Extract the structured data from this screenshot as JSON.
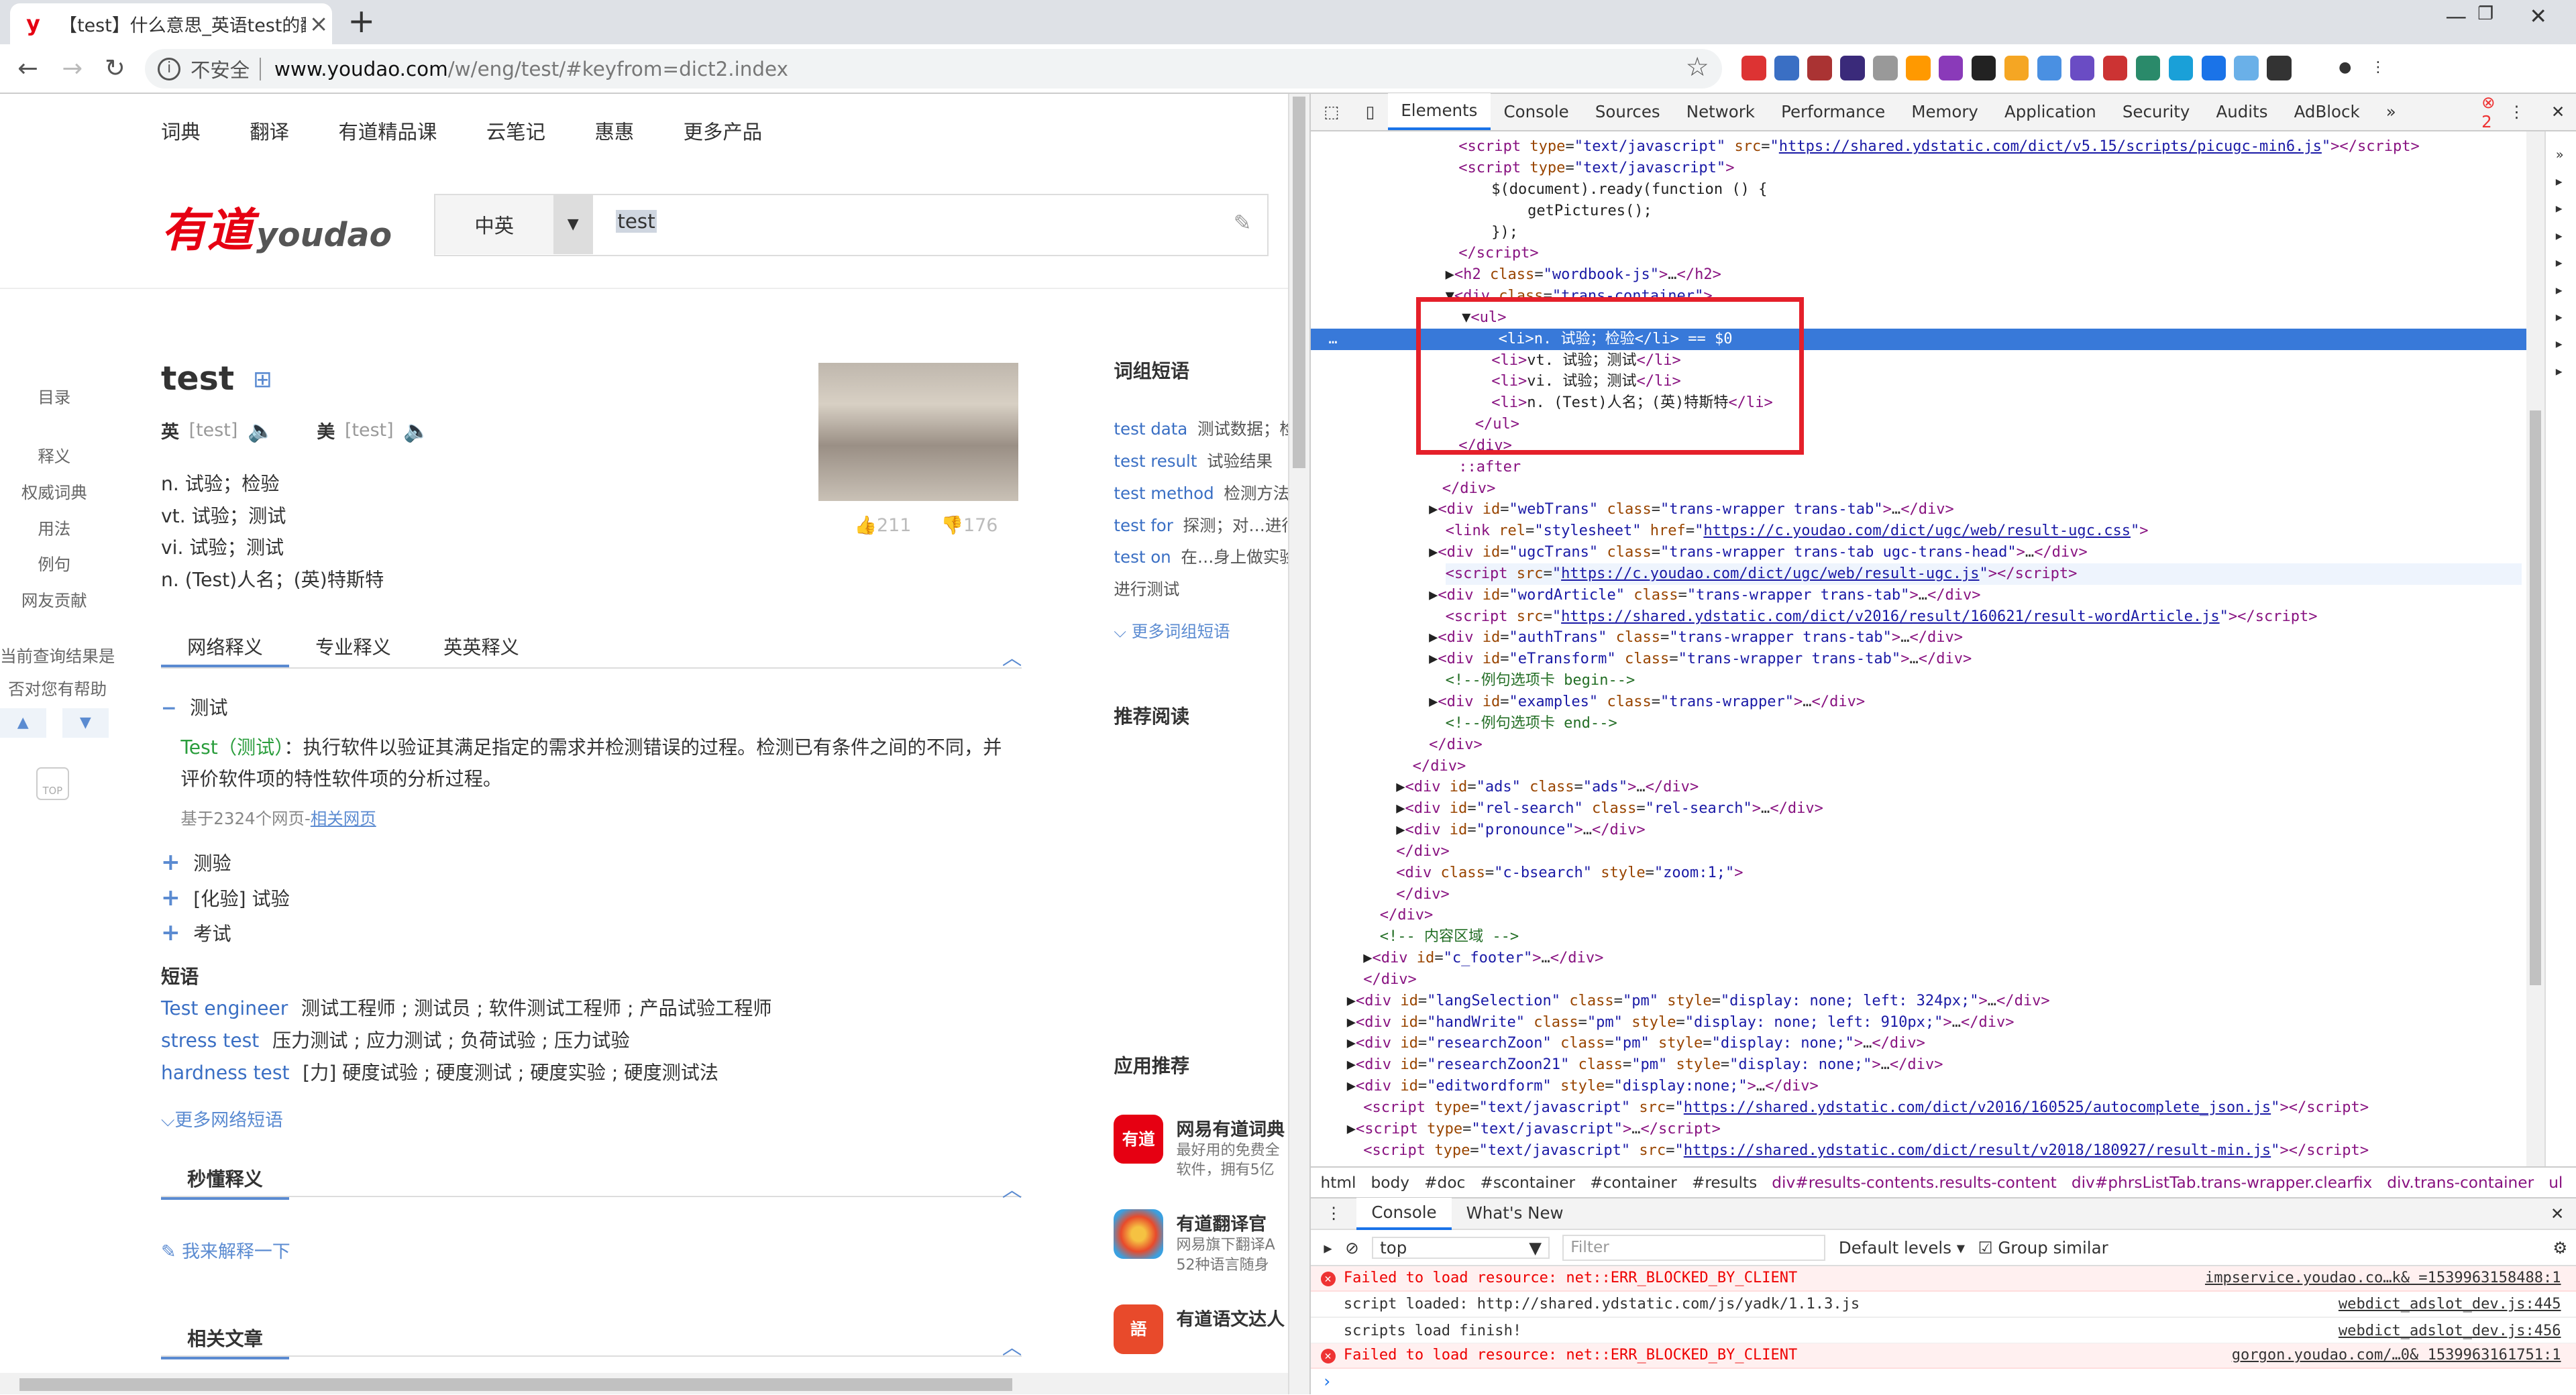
{
  "browser": {
    "tab_title": "【test】什么意思_英语test的翻译_音标_读音_用法_例句_在线翻译_有道词典",
    "tab_favicon": "y",
    "security": "不安全",
    "url_host": "www.youdao.com",
    "url_path": "/w/eng/test/#keyfrom=dict2.index"
  },
  "page": {
    "nav": [
      "词典",
      "翻译",
      "有道精品课",
      "云笔记",
      "惠惠",
      "更多产品"
    ],
    "logo_cn": "有道",
    "logo_en": "youdao",
    "lang_select": "中英",
    "search_value": "test",
    "toc": [
      "目录",
      "释义",
      "权威词典",
      "用法",
      "例句",
      "网友贡献"
    ],
    "side_note_1": "当前查询结果是",
    "side_note_2": "否对您有帮助",
    "top_label": "TOP",
    "word": "test",
    "phon_uk_label": "英",
    "phon_uk": "[test]",
    "phon_us_label": "美",
    "phon_us": "[test]",
    "defs": [
      "n. 试验；检验",
      "vt. 试验；测试",
      "vi. 试验；测试",
      "n. (Test)人名；(英)特斯特"
    ],
    "likes": "211",
    "dislikes": "176",
    "tabs": [
      "网络释义",
      "专业释义",
      "英英释义"
    ],
    "net_title": "测试",
    "net_kw": "Test",
    "net_kw_cn": "测试",
    "net_desc": "：执行软件以验证其满足指定的需求并检测错误的过程。检测已有条件之间的不同，并评价软件项的特性软件项的分析过程。",
    "net_src_prefix": "基于2324个网页-",
    "net_src_link": "相关网页",
    "plus_items": [
      "测验",
      "[化验] 试验",
      "考试"
    ],
    "phrase_title": "短语",
    "phrases": [
      {
        "k": "Test engineer",
        "v": "测试工程师 ; 测试员 ; 软件测试工程师 ; 产品试验工程师"
      },
      {
        "k": "stress test",
        "v": "压力测试 ; 应力测试 ; 负荷试验 ; 压力试验"
      },
      {
        "k": "hardness test",
        "v": "[力] 硬度试验 ; 硬度测试 ; 硬度实验 ; 硬度测试法"
      }
    ],
    "more_phrases": "更多网络短语",
    "sec_quick": "秒懂释义",
    "explain_link": "我来解释一下",
    "sec_related": "相关文章",
    "right_title": "词组短语",
    "right_phrases": [
      {
        "k": "test data",
        "v": "测试数据；检"
      },
      {
        "k": "test result",
        "v": "试验结果"
      },
      {
        "k": "test method",
        "v": "检测方法，"
      },
      {
        "k": "test for",
        "v": "探测；对…进行"
      },
      {
        "k": "test on",
        "v": "在…身上做实验"
      }
    ],
    "right_cont": "进行测试",
    "right_more": "更多词组短语",
    "recommend_title": "推荐阅读",
    "apps_title": "应用推荐",
    "apps": [
      {
        "icon": "有道",
        "name": "网易有道词典",
        "d1": "最好用的免费全",
        "d2": "软件，拥有5亿",
        "color": "#e60012"
      },
      {
        "icon": "",
        "name": "有道翻译官",
        "d1": "网易旗下翻译A",
        "d2": "52种语言随身",
        "color": "#3aa0e0"
      },
      {
        "icon": "語",
        "name": "有道语文达人",
        "d1": "",
        "d2": "",
        "color": "#e84a2b"
      }
    ]
  },
  "devtools": {
    "tabs": [
      "Elements",
      "Console",
      "Sources",
      "Network",
      "Performance",
      "Memory",
      "Application",
      "Security",
      "Audits",
      "AdBlock"
    ],
    "error_count": "2",
    "crumbs": [
      "html",
      "body",
      "#doc",
      "#scontainer",
      "#container",
      "#results",
      "div#results-contents.results-content",
      "div#phrsListTab.trans-wrapper.clearfix",
      "div.trans-container",
      "ul",
      "li"
    ],
    "drawer_tabs": [
      "Console",
      "What's New"
    ],
    "context": "top",
    "filter_placeholder": "Filter",
    "levels": "Default levels",
    "group_similar": "Group similar",
    "console": [
      {
        "type": "err",
        "msg": "Failed to load resource: net::ERR_BLOCKED_BY_CLIENT",
        "src": "impservice.youdao.co…k& =1539963158488:1"
      },
      {
        "type": "log",
        "msg": "script loaded:  http://shared.ydstatic.com/js/yadk/1.1.3.js",
        "src": "webdict_adslot_dev.js:445"
      },
      {
        "type": "log",
        "msg": "scripts load finish!",
        "src": "webdict_adslot_dev.js:456"
      },
      {
        "type": "err",
        "msg": "Failed to load resource: net::ERR_BLOCKED_BY_CLIENT",
        "src": "gorgon.youdao.com/…0& 1539963161751:1"
      }
    ]
  }
}
